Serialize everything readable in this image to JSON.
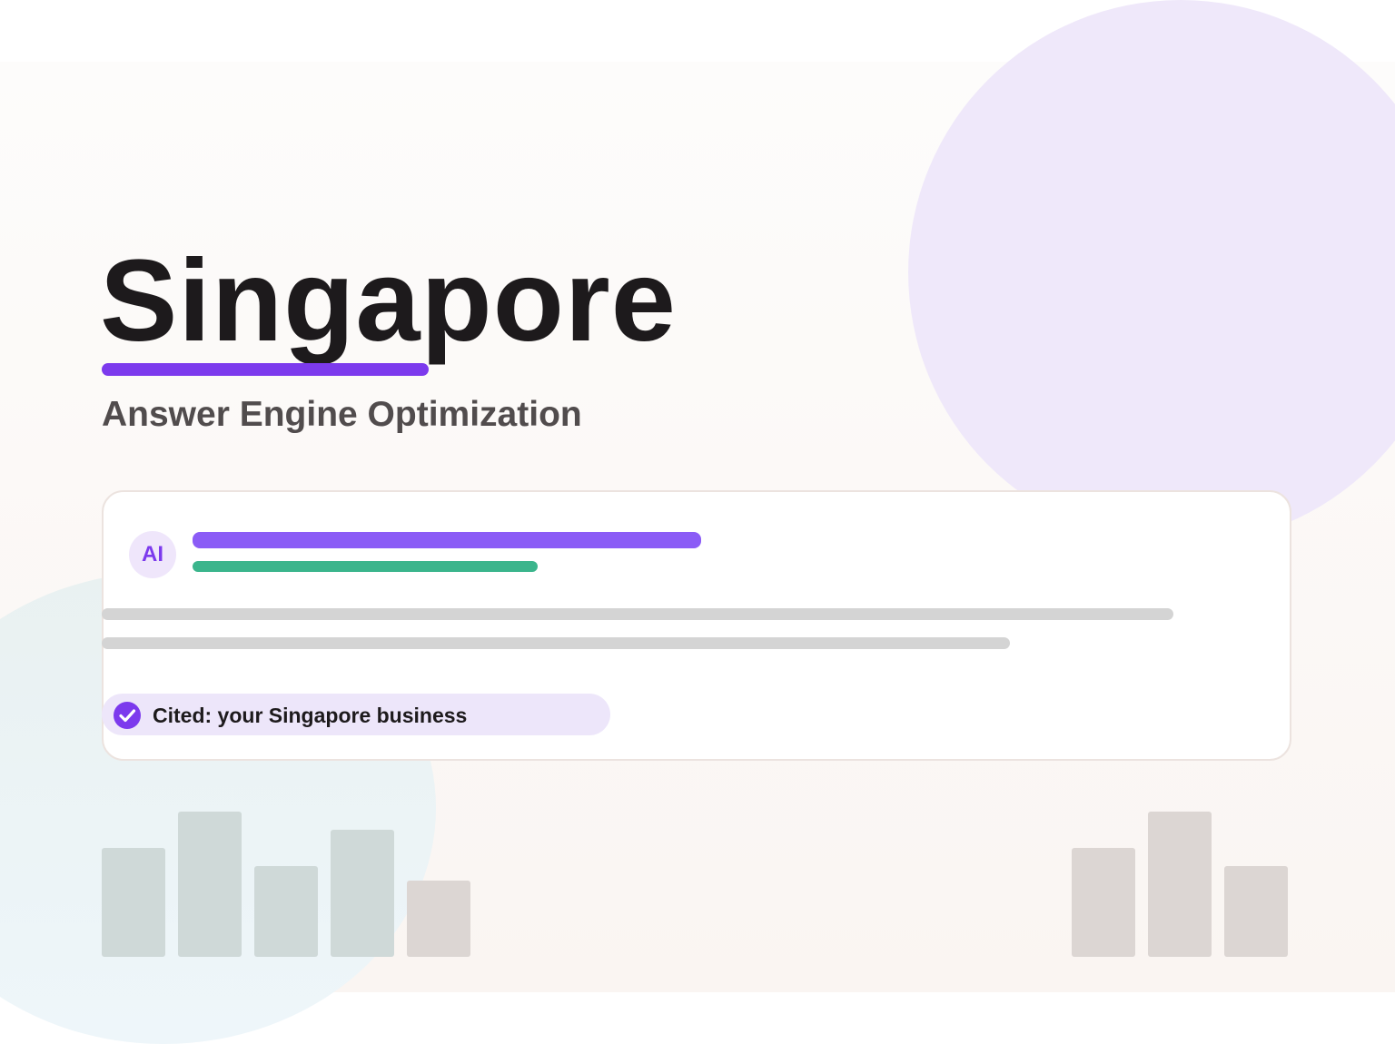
{
  "hero": {
    "title": "Singapore",
    "subtitle": "Answer Engine Optimization"
  },
  "answer_card": {
    "avatar_label": "AI",
    "citation_label": "Cited: your Singapore business",
    "citation_icon": "check-circle-icon"
  },
  "colors": {
    "accent_purple": "#7c3aed",
    "bar_purple": "#8b5cf6",
    "bar_green": "#3bb58c",
    "placeholder_gray": "#d4d4d4",
    "circle_purple": "#efe8fa",
    "circle_teal": "#e9f1f1",
    "pill_background": "#ede6fa"
  }
}
